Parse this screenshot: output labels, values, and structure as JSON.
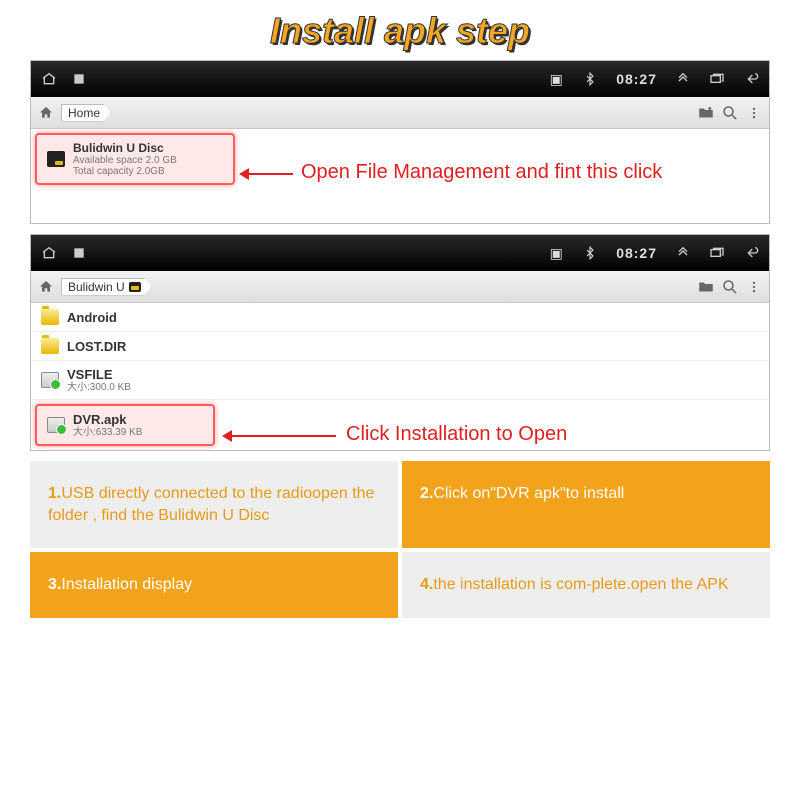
{
  "title": "Install apk step",
  "statusbar": {
    "time": "08:27"
  },
  "panel1": {
    "breadcrumb": "Home",
    "item": {
      "name": "Bulidwin U Disc",
      "line1": "Available space 2.0 GB",
      "line2": "Total capacity 2.0GB"
    },
    "annotation": "Open File Management and fint this click"
  },
  "panel2": {
    "breadcrumb": "Bulidwin U",
    "items": [
      {
        "name": "Android",
        "sub": "",
        "icon": "folder"
      },
      {
        "name": "LOST.DIR",
        "sub": "",
        "icon": "folder"
      },
      {
        "name": "VSFILE",
        "sub": "大小:300.0 KB",
        "icon": "apk"
      },
      {
        "name": "DVR.apk",
        "sub": "大小:633.39 KB",
        "icon": "apk",
        "highlight": true
      }
    ],
    "annotation": "Click Installation to Open"
  },
  "steps": {
    "s1": {
      "num": "1.",
      "text": "USB directly connected to the radioopen the folder , find the Bulidwin U Disc"
    },
    "s2": {
      "num": "2.",
      "text": "Click on\"DVR apk\"to install"
    },
    "s3": {
      "num": "3.",
      "text": "Installation display"
    },
    "s4": {
      "num": "4.",
      "text": "the installation is com-plete.open the APK"
    }
  }
}
